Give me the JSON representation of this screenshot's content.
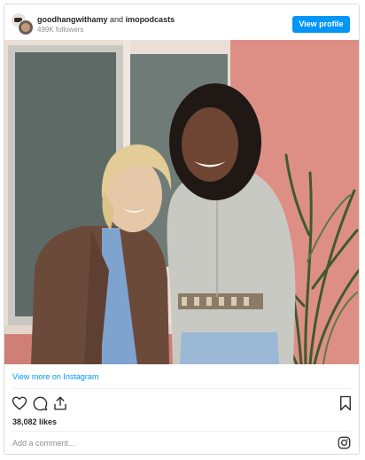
{
  "header": {
    "account_1": "goodhangwithamy",
    "joiner": "and",
    "account_2": "imopodcasts",
    "followers": "499K followers",
    "view_profile_label": "View profile"
  },
  "post": {
    "view_more_label": "View more on Instagram",
    "likes": "38,082 likes",
    "comment_placeholder": "Add a comment..."
  },
  "icons": {
    "like": "heart-icon",
    "comment": "comment-icon",
    "share": "share-icon",
    "save": "bookmark-icon",
    "instagram": "instagram-logo-icon"
  },
  "colors": {
    "accent": "#0095f6",
    "wall": "#d9857c",
    "text_muted": "#8e8e8e"
  }
}
